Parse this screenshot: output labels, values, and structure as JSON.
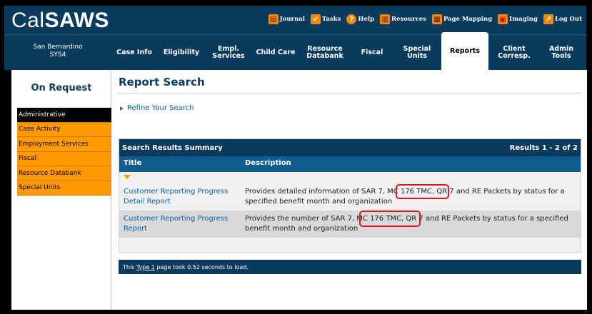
{
  "app": {
    "logo_light": "Cal",
    "logo_bold": "SAWS"
  },
  "utility": [
    {
      "label": "Journal",
      "icon": "journal-icon",
      "color": "#f08a00",
      "glyph": "📖"
    },
    {
      "label": "Tasks",
      "icon": "tasks-icon",
      "color": "#f08a00",
      "glyph": "✔"
    },
    {
      "label": "Help",
      "icon": "help-icon",
      "color": "#f08a00",
      "glyph": "?"
    },
    {
      "label": "Resources",
      "icon": "resources-icon",
      "color": "#f08a00",
      "glyph": "▤"
    },
    {
      "label": "Page Mapping",
      "icon": "page-mapping-icon",
      "color": "#f08a00",
      "glyph": "▥"
    },
    {
      "label": "Imaging",
      "icon": "imaging-icon",
      "color": "#f08a00",
      "glyph": "▦"
    },
    {
      "label": "Log Out",
      "icon": "log-out-icon",
      "color": "#f08a00",
      "glyph": "↗"
    }
  ],
  "nav": {
    "county_line1": "San Bernardino",
    "county_line2": "SYS4",
    "tabs": [
      {
        "label": "Case Info"
      },
      {
        "label": "Eligibility"
      },
      {
        "label": "Empl.\nServices"
      },
      {
        "label": "Child Care"
      },
      {
        "label": "Resource\nDatabank"
      },
      {
        "label": "Fiscal"
      },
      {
        "label": "Special\nUnits"
      },
      {
        "label": "Reports"
      },
      {
        "label": "Client\nCorresp."
      },
      {
        "label": "Admin Tools"
      }
    ],
    "active_tab": "Reports"
  },
  "sidebar": {
    "title": "On Request",
    "items": [
      {
        "label": "Administrative"
      },
      {
        "label": "Case Activity"
      },
      {
        "label": "Employment Services"
      },
      {
        "label": "Fiscal"
      },
      {
        "label": "Resource Databank"
      },
      {
        "label": "Special Units"
      }
    ],
    "active_item": "Administrative"
  },
  "main": {
    "title": "Report Search",
    "refine_label": "Refine Your Search",
    "results": {
      "header": "Search Results Summary",
      "count_text": "Results 1 - 2 of 2",
      "columns": {
        "title": "Title",
        "description": "Description"
      },
      "rows": [
        {
          "title": "Customer Reporting Progress Detail Report",
          "description": "Provides detailed information of SAR 7, MC 176 TMC, QR 7 and RE Packets by status for a specified benefit month and organization"
        },
        {
          "title": "Customer Reporting Progress Report",
          "description": "Provides the number of SAR 7, MC 176 TMC, QR 7 and RE Packets by status for a specified benefit month and organization"
        }
      ]
    },
    "footer": {
      "prefix": "This ",
      "link": "Type 1",
      "suffix": " page took 0.52 seconds to load."
    }
  },
  "colors": {
    "header_bg": "#0a3a5c",
    "sidebar_orange": "#ff9900",
    "link_blue": "#0a5fa8",
    "highlight_red": "#e0191e"
  }
}
